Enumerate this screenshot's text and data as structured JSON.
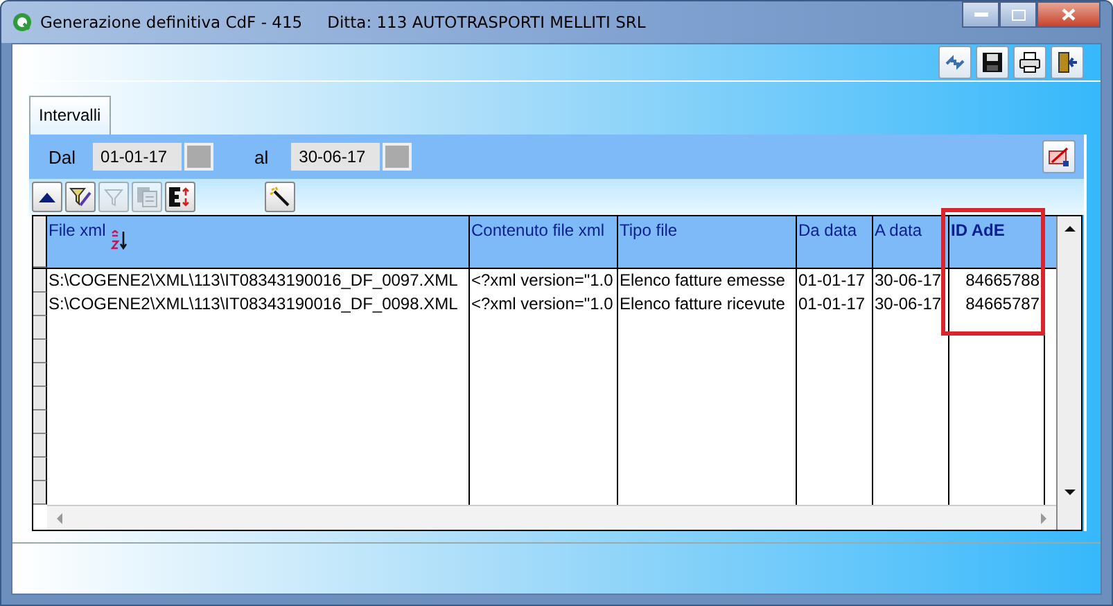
{
  "window": {
    "title": "Generazione definitiva CdF - 415",
    "company": "Ditta: 113  AUTOTRASPORTI MELLITI SRL"
  },
  "tabs": [
    {
      "label": "Intervalli",
      "selected": true
    }
  ],
  "filter": {
    "from_label": "Dal",
    "from_value": "01-01-17",
    "to_label": "al",
    "to_value": "30-06-17"
  },
  "grid_toolbar": [
    {
      "kind": "up",
      "disabled": false
    },
    {
      "kind": "edit-filter",
      "disabled": false
    },
    {
      "kind": "filter",
      "disabled": true
    },
    {
      "kind": "copy",
      "disabled": true
    },
    {
      "kind": "export",
      "disabled": false
    },
    {
      "kind": "wand",
      "disabled": false
    }
  ],
  "table": {
    "columns": [
      {
        "label": "File xml",
        "sorted": true,
        "highlighted": false
      },
      {
        "label": "Contenuto file xml",
        "sorted": false,
        "highlighted": false
      },
      {
        "label": "Tipo file",
        "sorted": false,
        "highlighted": false
      },
      {
        "label": "Da data",
        "sorted": false,
        "highlighted": false
      },
      {
        "label": "A data",
        "sorted": false,
        "highlighted": false
      },
      {
        "label": "ID AdE",
        "sorted": false,
        "highlighted": true
      }
    ],
    "rows": [
      [
        "S:\\COGENE2\\XML\\113\\IT08343190016_DF_0097.XML",
        "<?xml version=\"1.0",
        "Elenco fatture emesse",
        "01-01-17",
        "30-06-17",
        "84665788"
      ],
      [
        "S:\\COGENE2\\XML\\113\\IT08343190016_DF_0098.XML",
        "<?xml version=\"1.0",
        "Elenco fatture ricevute",
        "01-01-17",
        "30-06-17",
        "84665787"
      ]
    ]
  }
}
